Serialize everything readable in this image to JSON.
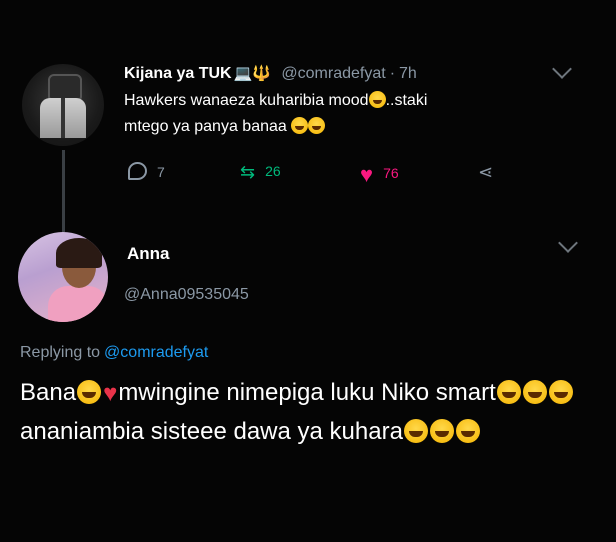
{
  "tweet": {
    "author_name": "Kijana ya TUK",
    "badges": "💻🔱",
    "handle": "@comradefyat",
    "separator": "·",
    "time": "7h",
    "text_line1": "Hawkers wanaeza kuharibia mood",
    "text_line1_end": "..staki",
    "text_line2": "mtego ya panya banaa",
    "stats": {
      "replies": "7",
      "retweets": "26",
      "likes": "76"
    },
    "icons": [
      "reply-icon",
      "retweet-icon",
      "heart-icon",
      "share-icon",
      "chevron-down-icon"
    ]
  },
  "reply": {
    "author_name": "Anna",
    "handle": "@Anna09535045",
    "replying_label": "Replying to",
    "replying_handle": "@comradefyat",
    "segment1": "Bana",
    "segment2": "mwingine nimepiga luku Niko smart",
    "segment3": "ananiambia sisteee dawa ya kuhara"
  },
  "colors": {
    "background": "#050505",
    "text": "#ffffff",
    "muted": "#8b98a5",
    "link": "#1d9bf0",
    "retweet": "#00ba7c",
    "like": "#f91880"
  }
}
